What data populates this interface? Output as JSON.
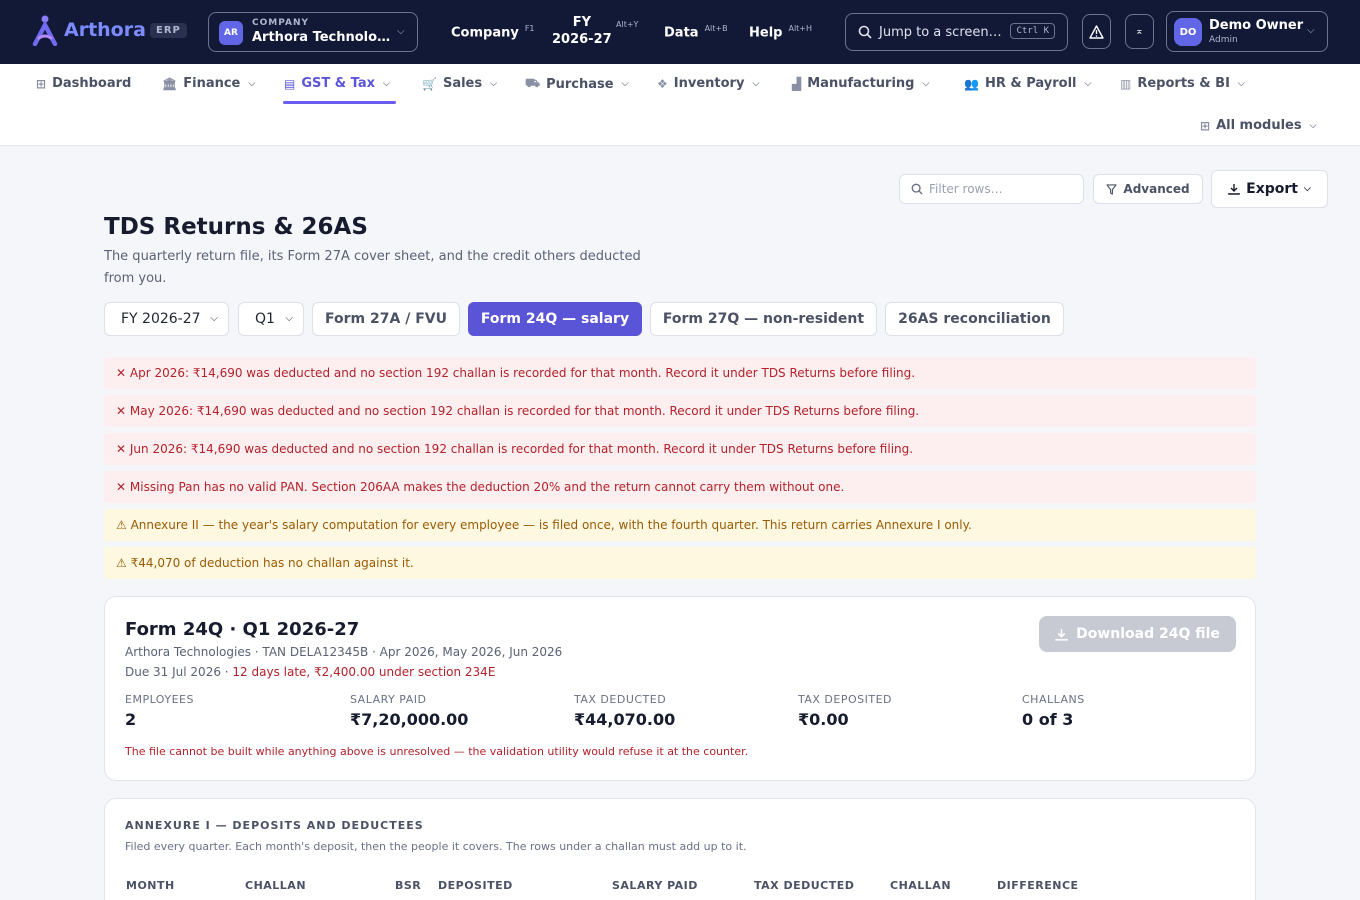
{
  "topbar": {
    "brand": "Arthora",
    "badge": "ERP",
    "company_caption": "COMPANY",
    "company_initials": "AR",
    "company_name": "Arthora Technolo…",
    "menus": [
      {
        "label": "Company",
        "shortcut": "F1"
      },
      {
        "label": "Data",
        "shortcut": "Alt+B"
      },
      {
        "label": "Help",
        "shortcut": "Alt+H"
      }
    ],
    "fy_label": "FY",
    "fy_value": "2026-27",
    "fy_shortcut": "Alt+Y",
    "search_placeholder": "Jump to a screen…",
    "search_shortcut": "Ctrl K",
    "user_initials": "DO",
    "user_name": "Demo Owner",
    "user_role": "Admin"
  },
  "nav": {
    "items": [
      {
        "label": "Dashboard",
        "icon": "grid-icon"
      },
      {
        "label": "Finance",
        "icon": "bank-icon"
      },
      {
        "label": "GST & Tax",
        "icon": "document-icon"
      },
      {
        "label": "Sales",
        "icon": "cart-icon"
      },
      {
        "label": "Purchase",
        "icon": "truck-icon"
      },
      {
        "label": "Inventory",
        "icon": "boxes-icon"
      },
      {
        "label": "Manufacturing",
        "icon": "factory-icon"
      },
      {
        "label": "HR & Payroll",
        "icon": "people-icon"
      },
      {
        "label": "Reports & BI",
        "icon": "chart-icon"
      }
    ],
    "all_modules": "All modules",
    "accent": "#5a55d6"
  },
  "toolbar": {
    "filter_placeholder": "Filter rows…",
    "advanced_label": "Advanced",
    "export_label": "Export"
  },
  "page": {
    "title": "TDS Returns & 26AS",
    "subtitle": "The quarterly return file, its Form 27A cover sheet, and the credit others deducted from you.",
    "fy_select": "FY 2026-27",
    "quarter_select": "Q1",
    "tabs": [
      "Form 27A / FVU",
      "Form 24Q — salary",
      "Form 27Q — non-resident",
      "26AS reconciliation"
    ]
  },
  "alerts": [
    {
      "type": "error",
      "icon": "✕",
      "text": "Apr 2026: ₹14,690 was deducted and no section 192 challan is recorded for that month. Record it under TDS Returns before filing."
    },
    {
      "type": "error",
      "icon": "✕",
      "text": "May 2026: ₹14,690 was deducted and no section 192 challan is recorded for that month. Record it under TDS Returns before filing."
    },
    {
      "type": "error",
      "icon": "✕",
      "text": "Jun 2026: ₹14,690 was deducted and no section 192 challan is recorded for that month. Record it under TDS Returns before filing."
    },
    {
      "type": "error",
      "icon": "✕",
      "text": "Missing Pan has no valid PAN. Section 206AA makes the deduction 20% and the return cannot carry them without one."
    },
    {
      "type": "warning",
      "icon": "⚠",
      "text": "Annexure II — the year's salary computation for every employee — is filed once, with the fourth quarter. This return carries Annexure I only."
    },
    {
      "type": "warning",
      "icon": "⚠",
      "text": "₹44,070 of deduction has no challan against it."
    }
  ],
  "summary": {
    "title": "Form 24Q · Q1 2026-27",
    "line1": "Arthora Technologies · TAN DELA12345B · Apr 2026, May 2026, Jun 2026",
    "due": "Due 31 Jul 2026 · ",
    "late": "12 days late, ₹2,400.00 under section 234E",
    "download_label": "Download 24Q file",
    "stats": [
      {
        "label": "EMPLOYEES",
        "value": "2"
      },
      {
        "label": "SALARY PAID",
        "value": "₹7,20,000.00"
      },
      {
        "label": "TAX DEDUCTED",
        "value": "₹44,070.00"
      },
      {
        "label": "TAX DEPOSITED",
        "value": "₹0.00"
      },
      {
        "label": "CHALLANS",
        "value": "0 of 3"
      }
    ],
    "note": "The file cannot be built while anything above is unresolved — the validation utility would refuse it at the counter."
  },
  "annexure": {
    "title": "ANNEXURE I — DEPOSITS AND DEDUCTEES",
    "subtitle": "Filed every quarter. Each month's deposit, then the people it covers. The rows under a challan must add up to it.",
    "columns": [
      "MONTH",
      "CHALLAN",
      "BSR",
      "DEPOSITED",
      "SALARY PAID",
      "TAX DEDUCTED",
      "CHALLAN",
      "DIFFERENCE"
    ]
  }
}
